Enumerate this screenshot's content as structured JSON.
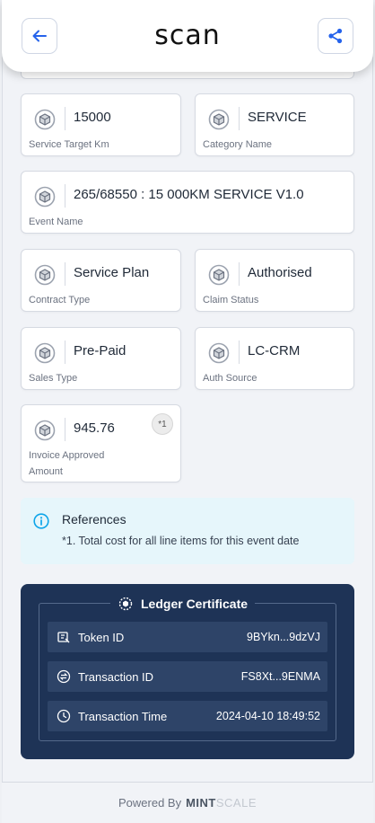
{
  "header": {
    "logo": "scan"
  },
  "fields": [
    {
      "value": "15000",
      "label": "Service Target Km"
    },
    {
      "value": "SERVICE",
      "label": "Category Name"
    },
    {
      "value": "265/68550 : 15 000KM SERVICE V1.0",
      "label": "Event Name"
    },
    {
      "value": "Service Plan",
      "label": "Contract Type"
    },
    {
      "value": "Authorised",
      "label": "Claim Status"
    },
    {
      "value": "Pre-Paid",
      "label": "Sales Type"
    },
    {
      "value": "LC-CRM",
      "label": "Auth Source"
    },
    {
      "value": "945.76",
      "label": "Invoice Approved Amount",
      "ref": "*1"
    }
  ],
  "references": {
    "title": "References",
    "text": "*1. Total cost for all line items for this event date"
  },
  "ledger": {
    "title": "Ledger Certificate",
    "rows": [
      {
        "key": "Token ID",
        "value": "9BYkn...9dzVJ",
        "icon": "token-icon"
      },
      {
        "key": "Transaction ID",
        "value": "FS8Xt...9ENMA",
        "icon": "transaction-icon"
      },
      {
        "key": "Transaction Time",
        "value": "2024-04-10 18:49:52",
        "icon": "clock-icon"
      }
    ]
  },
  "footer": {
    "powered": "Powered By",
    "brand_a": "MINT",
    "brand_b": "SCALE"
  },
  "colors": {
    "accent": "#2563eb",
    "ledger_bg": "#1e3356",
    "info_bg": "#e6f6fb",
    "info_icon": "#0ea5e9"
  }
}
